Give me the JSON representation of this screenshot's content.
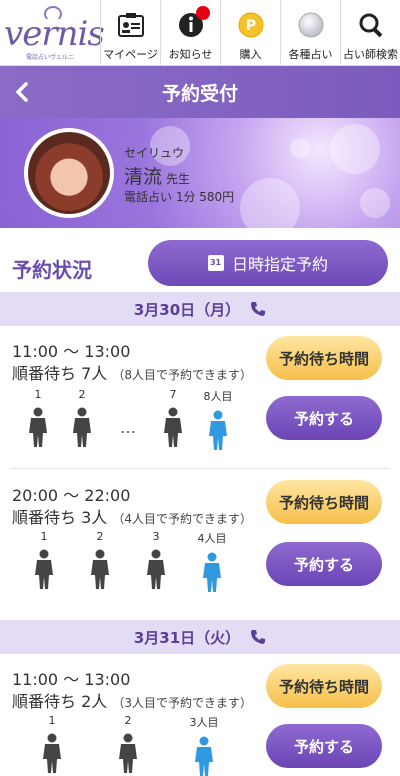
{
  "logo": {
    "text": "vernis",
    "sub": "電話占いヴェルニ"
  },
  "nav": [
    {
      "label": "マイページ",
      "icon": "mypage-icon"
    },
    {
      "label": "お知らせ",
      "icon": "info-icon",
      "badge": true
    },
    {
      "label": "購入",
      "icon": "coin-icon"
    },
    {
      "label": "各種占い",
      "icon": "crystal-ball-icon"
    },
    {
      "label": "占い師検索",
      "icon": "search-icon"
    }
  ],
  "header": {
    "title": "予約受付"
  },
  "profile": {
    "kana": "セイリュウ",
    "name": "清流",
    "suffix": "先生",
    "price": "電話占い 1分 580円"
  },
  "status": {
    "heading": "予約状況",
    "datetime_button": "日時指定予約"
  },
  "dates": [
    {
      "label": "3月30日（月）",
      "slots": [
        {
          "time": "11:00 〜 13:00",
          "queue": "順番待ち 7人",
          "note": "（8人目で予約できます）",
          "people": [
            "1",
            "2",
            "7",
            "8人目"
          ],
          "wait_label": "予約待ち時間",
          "book_label": "予約する"
        },
        {
          "time": "20:00 〜 22:00",
          "queue": "順番待ち 3人",
          "note": "（4人目で予約できます）",
          "people": [
            "1",
            "2",
            "3",
            "4人目"
          ],
          "wait_label": "予約待ち時間",
          "book_label": "予約する"
        }
      ]
    },
    {
      "label": "3月31日（火）",
      "slots": [
        {
          "time": "11:00 〜 13:00",
          "queue": "順番待ち 2人",
          "note": "（3人目で予約できます）",
          "people": [
            "1",
            "2",
            "3人目"
          ],
          "wait_label": "予約待ち時間",
          "book_label": "予約する"
        }
      ]
    }
  ],
  "colors": {
    "accent": "#7b5cbe",
    "person_grey": "#444444",
    "person_blue": "#2f9ae0",
    "wait_btn": "#f5c04a"
  }
}
